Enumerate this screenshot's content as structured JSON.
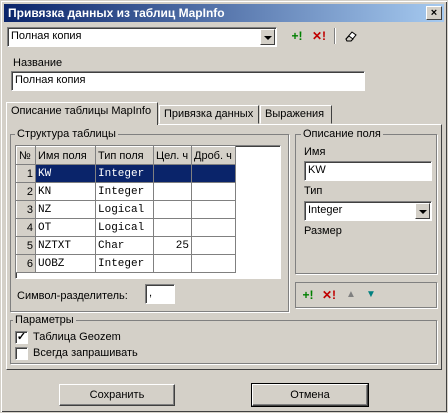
{
  "window": {
    "title": "Привязка данных из таблиц MapInfo",
    "close_glyph": "×"
  },
  "toolbar": {
    "preset_value": "Полная копия",
    "add_label": "+!",
    "delete_label": "✕!",
    "eraser_icon": "eraser-icon"
  },
  "name": {
    "label": "Название",
    "value": "Полная копия"
  },
  "tabs": [
    {
      "label": "Описание таблицы  MapInfo",
      "active": true
    },
    {
      "label": "Привязка данных",
      "active": false
    },
    {
      "label": "Выражения",
      "active": false
    }
  ],
  "structure": {
    "group_label": "Структура таблицы",
    "columns": [
      "№",
      "Имя поля",
      "Тип поля",
      "Цел. ч",
      "Дроб. ч"
    ],
    "rows": [
      {
        "num": "1",
        "name": "KW",
        "type": "Integer",
        "int": "",
        "frac": "",
        "selected": true
      },
      {
        "num": "2",
        "name": "KN",
        "type": "Integer",
        "int": "",
        "frac": ""
      },
      {
        "num": "3",
        "name": "NZ",
        "type": "Logical",
        "int": "",
        "frac": ""
      },
      {
        "num": "4",
        "name": "OT",
        "type": "Logical",
        "int": "",
        "frac": ""
      },
      {
        "num": "5",
        "name": "NZTXT",
        "type": "Char",
        "int": "25",
        "frac": ""
      },
      {
        "num": "6",
        "name": "UOBZ",
        "type": "Integer",
        "int": "",
        "frac": ""
      }
    ],
    "separator_label": "Символ-разделитель:",
    "separator_value": ","
  },
  "field": {
    "group_label": "Описание поля",
    "name_label": "Имя",
    "name_value": "KW",
    "type_label": "Тип",
    "type_value": "Integer",
    "size_label": "Размер"
  },
  "fieldbar": {
    "add": "+!",
    "delete": "✕!",
    "up": "▲",
    "down": "▼"
  },
  "params": {
    "group_label": "Параметры",
    "geozem_label": "Таблица Geozem",
    "geozem_checked": "✓",
    "always_ask_label": "Всегда запрашивать",
    "always_ask_checked": ""
  },
  "buttons": {
    "save": "Сохранить",
    "cancel": "Отмена"
  }
}
